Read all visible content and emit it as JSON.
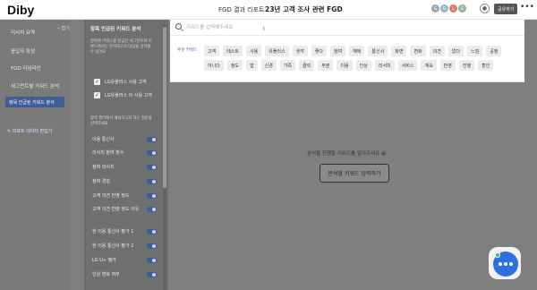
{
  "header": {
    "logo": "Diby",
    "breadcrumb": "FGD 결과 리포트",
    "title": "23년 고객 조사 관련 FGD",
    "avatars": [
      {
        "initial": "G",
        "color": "#9aa3ae"
      },
      {
        "initial": "G",
        "color": "#8fb7c9"
      },
      {
        "initial": "L",
        "color": "#e07a6a"
      },
      {
        "initial": "G",
        "color": "#8fb59a"
      }
    ],
    "share_label": "공유하기",
    "more_label": "•••"
  },
  "leftnav": {
    "collapse_label": "접기",
    "items": [
      "리서치 요약",
      "응답자 특성",
      "FGD 타임라인",
      "세그먼트별 키워드 분석"
    ],
    "active_item": "항목 인급된 키워드 분석",
    "raw_link": "리포트 데이터 편집기"
  },
  "panel": {
    "title": "항목 언급된 키워드 분석",
    "description": "항목에 키워드를 언급한 세그먼트와 트렌드에서는 분석하고자 대상을 선택할 수 있어요",
    "checkboxes": [
      "LG유플러스 사용 고객",
      "LG유플러스 이 사용 고객"
    ],
    "description2": "항목 필터에서 제외하고자 하는 질문을 선택하세요",
    "toggles": [
      "이용 통신사",
      "리서치 참여 횟수",
      "참여 리서치",
      "참여 경험",
      "고객 의견 반영 정도",
      "고객 의견 반영 정도 이유",
      "현 이용 통신사 평가 1",
      "현 이용 통신사 평가 2",
      "LG U+ 평가",
      "인상 변화 여부"
    ]
  },
  "search": {
    "placeholder": "키워드를 입력해주세요",
    "caret": "I",
    "recommend_label": "추천 키워드",
    "tags": [
      "고객",
      "테스트",
      "사용",
      "유플러스",
      "생각",
      "좋다",
      "참여",
      "혜택",
      "통신사",
      "화면",
      "변화",
      "의견",
      "없다",
      "느낌",
      "공정",
      "아니다",
      "정도",
      "앱",
      "신경",
      "가족",
      "클릭",
      "부분",
      "이용",
      "인상",
      "리서치",
      "서비스",
      "계속",
      "반영",
      "진행",
      "할인"
    ]
  },
  "main": {
    "empty_text": "분석을 진행할 키워드를 알려주세요 😀",
    "empty_button": "분석할 키워드 입력하기"
  },
  "colors": {
    "accent": "#3f5e99",
    "chat": "#2f6fe0"
  }
}
